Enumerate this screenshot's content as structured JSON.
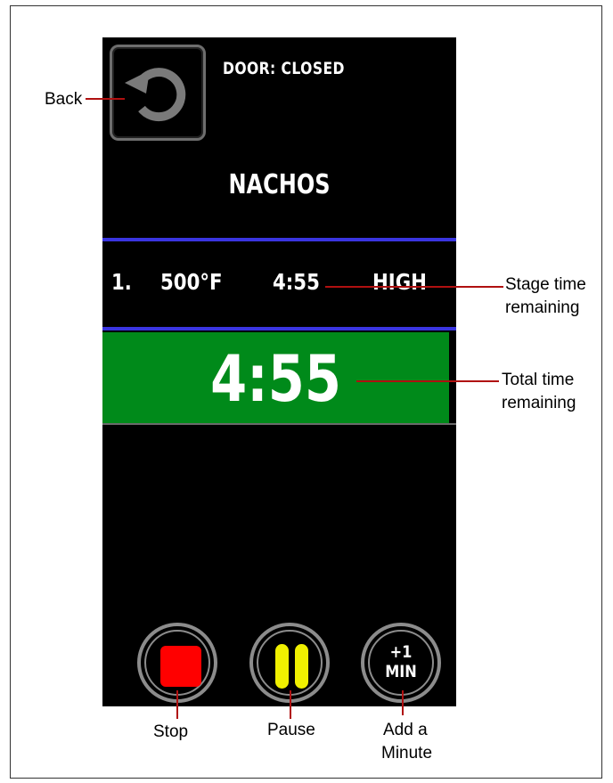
{
  "header": {
    "door_status": "DOOR: CLOSED"
  },
  "recipe": {
    "name": "NACHOS"
  },
  "stage": {
    "number": "1.",
    "temperature": "500°F",
    "time": "4:55",
    "power": "HIGH"
  },
  "timer": {
    "total_remaining": "4:55"
  },
  "buttons": {
    "add_minute_line1": "+1",
    "add_minute_line2": "MIN"
  },
  "annotations": {
    "back": "Back",
    "stage_time": "Stage time remaining",
    "stage_time_line1": "Stage time",
    "stage_time_line2": "remaining",
    "total_time_line1": "Total time",
    "total_time_line2": "remaining",
    "stop": "Stop",
    "pause": "Pause",
    "add_minute_line1": "Add a",
    "add_minute_line2": "Minute"
  },
  "colors": {
    "screen_bg": "#000000",
    "accent_line": "#3a35e0",
    "timer_bg": "#008a1a",
    "stop": "#ff0000",
    "pause": "#f0f000",
    "leader": "#b01010"
  },
  "icons": {
    "back": "refresh-arrow-icon",
    "stop": "stop-square-icon",
    "pause": "pause-bars-icon"
  }
}
